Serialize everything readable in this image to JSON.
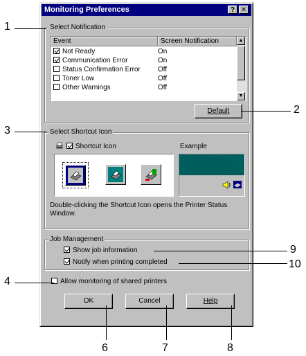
{
  "window": {
    "title": "Monitoring Preferences",
    "help_glyph": "?",
    "close_glyph": "✕"
  },
  "notification": {
    "group_label": "Select Notification",
    "col_event": "Event",
    "col_screen": "Screen Notification",
    "rows": [
      {
        "checked": true,
        "event": "Not Ready",
        "value": "On"
      },
      {
        "checked": true,
        "event": "Communication Error",
        "value": "On"
      },
      {
        "checked": false,
        "event": "Status Confirmation Error",
        "value": "Off"
      },
      {
        "checked": false,
        "event": "Toner Low",
        "value": "Off"
      },
      {
        "checked": false,
        "event": "Other Warnings",
        "value": "Off"
      }
    ],
    "default_button": "Default"
  },
  "shortcut": {
    "group_label": "Select Shortcut Icon",
    "checkbox_label": "Shortcut Icon",
    "checked": true,
    "example_label": "Example",
    "description": "Double-clicking the Shortcut Icon opens the Printer Status Window."
  },
  "job": {
    "group_label": "Job Management",
    "show_info": "Show job information",
    "notify": "Notify when printing completed"
  },
  "shared": {
    "label": "Allow monitoring of shared printers",
    "checked": false
  },
  "buttons": {
    "ok": "OK",
    "cancel": "Cancel",
    "help": "Help"
  },
  "callouts": {
    "c1": "1",
    "c2": "2",
    "c3": "3",
    "c4": "4",
    "c6": "6",
    "c7": "7",
    "c8": "8",
    "c9": "9",
    "c10": "10"
  },
  "colors": {
    "titlebar": "#000080",
    "example_teal": "#006666",
    "dialog": "#c0c0c0"
  }
}
